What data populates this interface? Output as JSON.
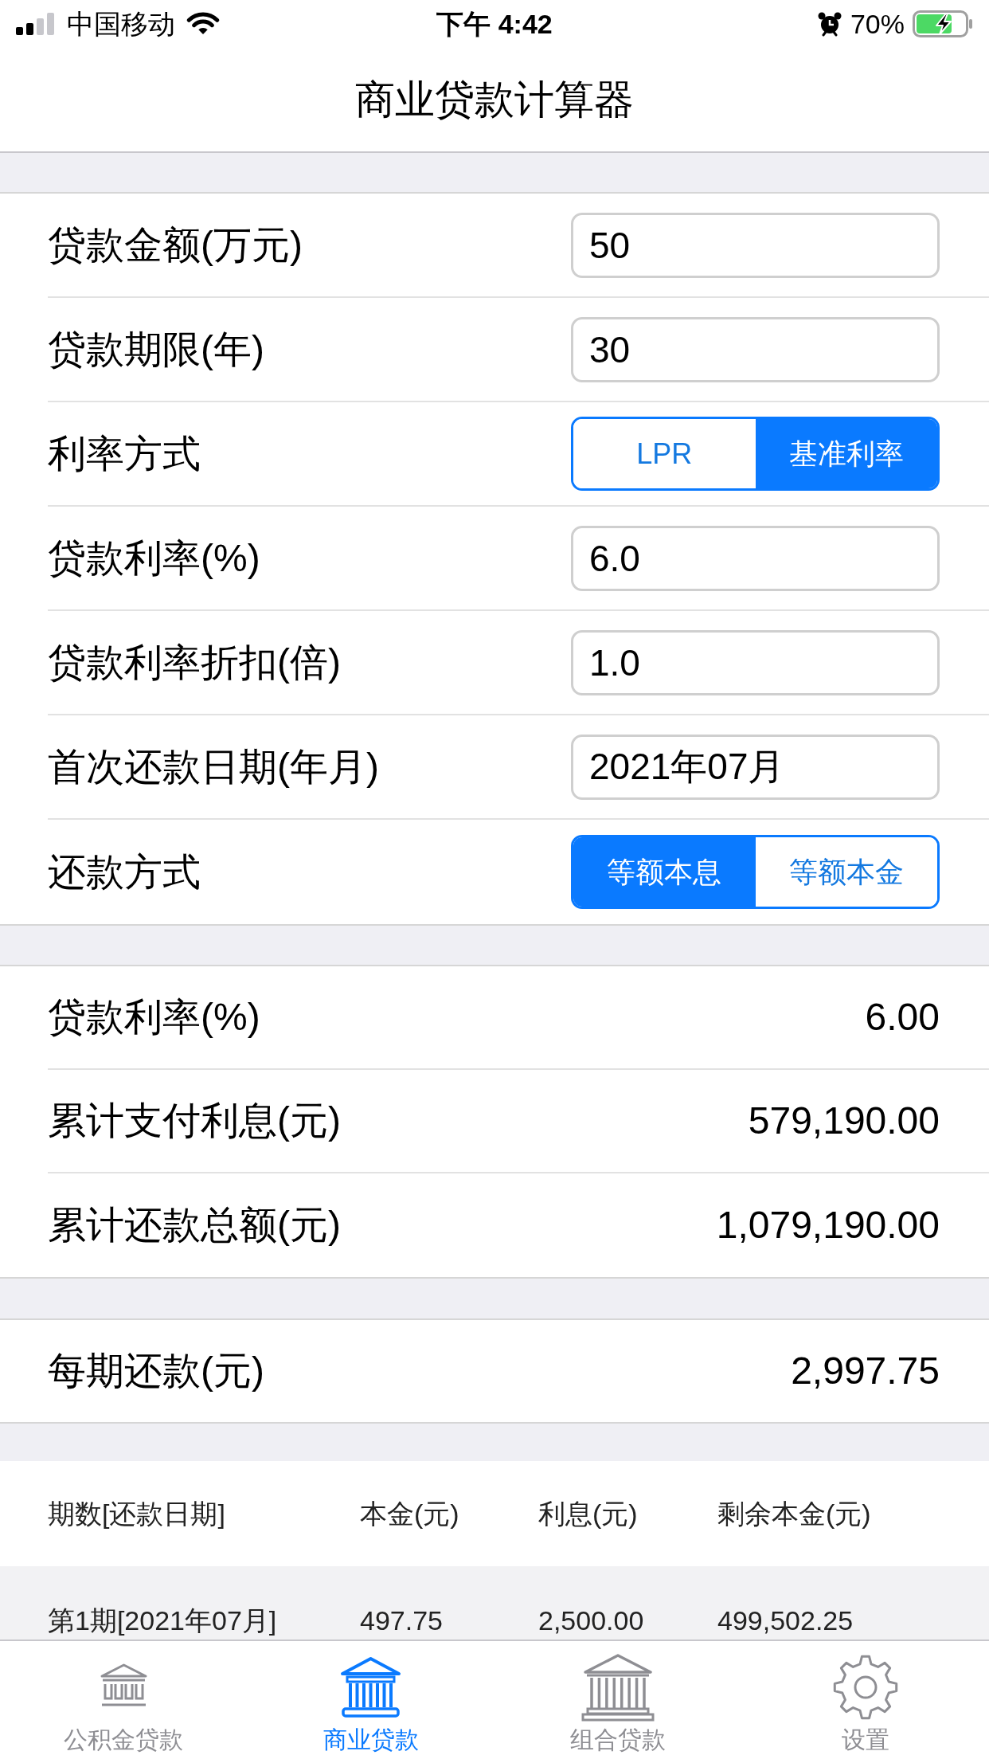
{
  "status_bar": {
    "carrier": "中国移动",
    "time": "下午 4:42",
    "battery": "70%"
  },
  "nav": {
    "title": "商业贷款计算器"
  },
  "form": {
    "rows": [
      {
        "kind": "input",
        "label": "贷款金额(万元)",
        "value": "50"
      },
      {
        "kind": "input",
        "label": "贷款期限(年)",
        "value": "30"
      },
      {
        "kind": "segmented",
        "label": "利率方式",
        "options": [
          {
            "label": "LPR",
            "selected": false
          },
          {
            "label": "基准利率",
            "selected": true
          }
        ]
      },
      {
        "kind": "input",
        "label": "贷款利率(%)",
        "value": "6.0"
      },
      {
        "kind": "input",
        "label": "贷款利率折扣(倍)",
        "value": "1.0"
      },
      {
        "kind": "input",
        "label": "首次还款日期(年月)",
        "value": "2021年07月"
      },
      {
        "kind": "segmented",
        "label": "还款方式",
        "options": [
          {
            "label": "等额本息",
            "selected": true
          },
          {
            "label": "等额本金",
            "selected": false
          }
        ]
      }
    ]
  },
  "results": {
    "rows": [
      {
        "label": "贷款利率(%)",
        "value": "6.00"
      },
      {
        "label": "累计支付利息(元)",
        "value": "579,190.00"
      },
      {
        "label": "累计还款总额(元)",
        "value": "1,079,190.00"
      }
    ]
  },
  "payment": {
    "label": "每期还款(元)",
    "value": "2,997.75"
  },
  "schedule": {
    "columns": [
      "期数[还款日期]",
      "本金(元)",
      "利息(元)",
      "剩余本金(元)"
    ],
    "rows": [
      [
        "第1期[2021年07月]",
        "497.75",
        "2,500.00",
        "499,502.25"
      ]
    ]
  },
  "tab_bar": {
    "items": [
      {
        "label": "公积金贷款",
        "selected": false
      },
      {
        "label": "商业贷款",
        "selected": true
      },
      {
        "label": "组合贷款",
        "selected": false
      },
      {
        "label": "设置",
        "selected": false
      }
    ]
  }
}
